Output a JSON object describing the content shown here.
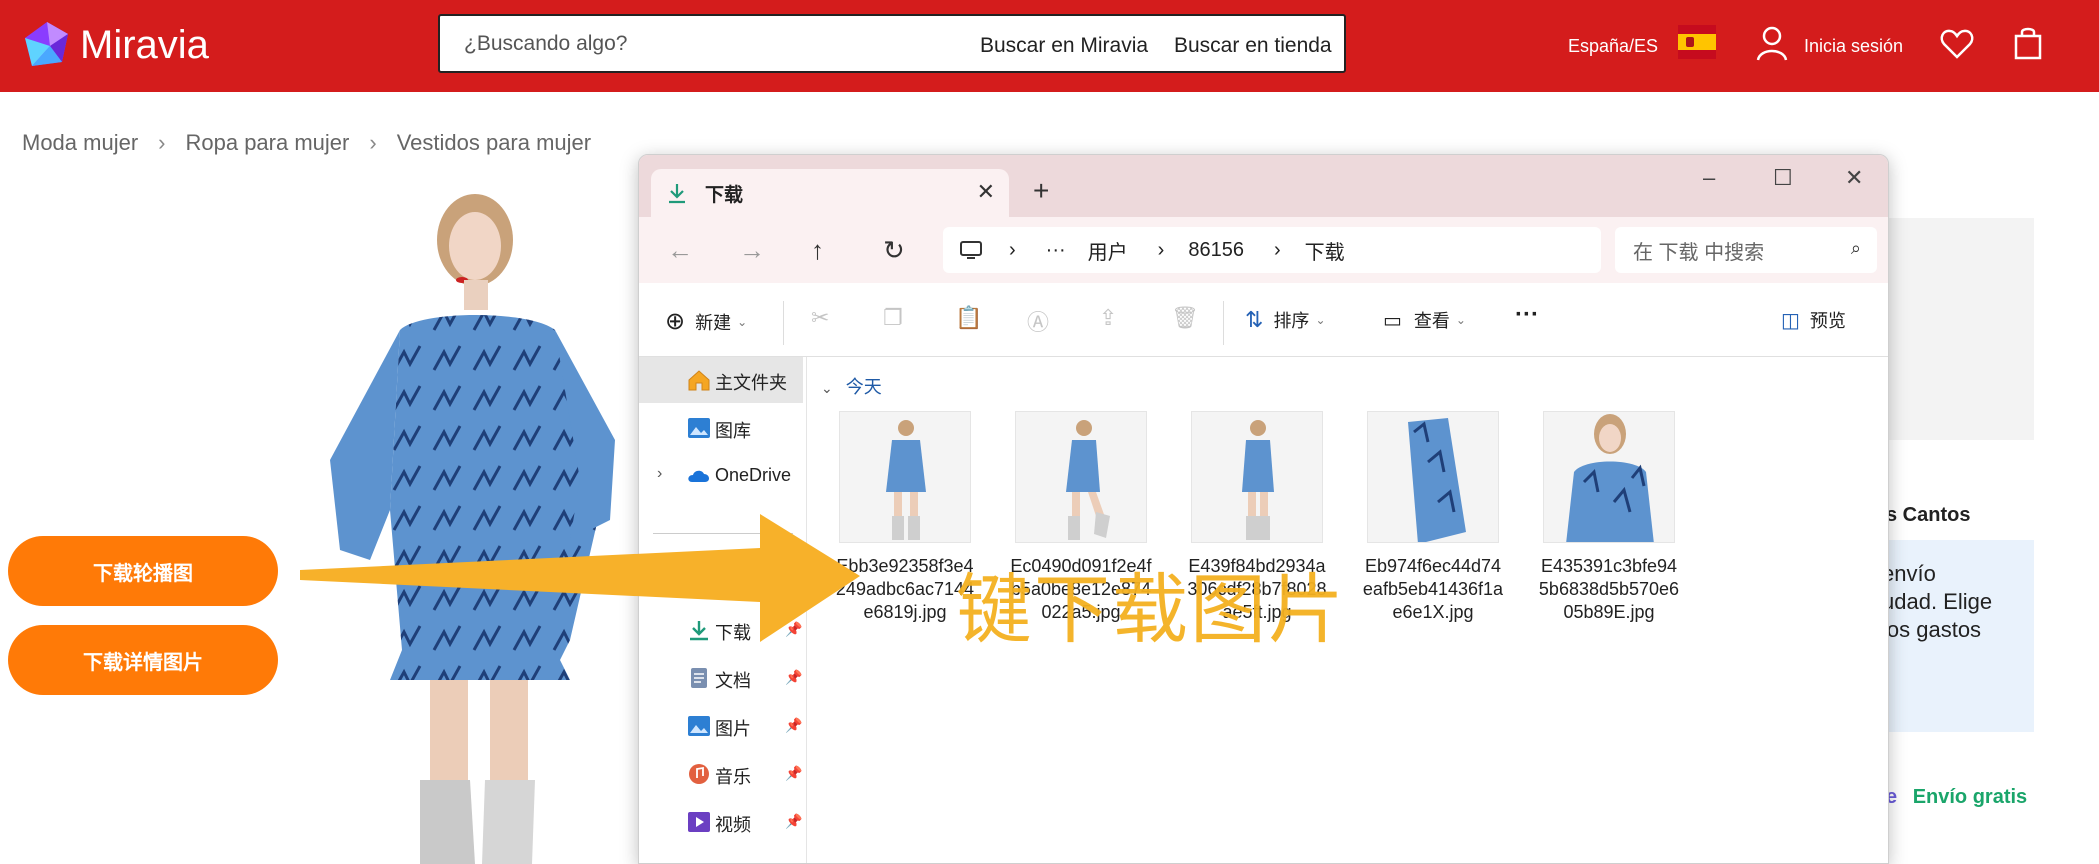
{
  "header": {
    "brand": "Miravia",
    "search_placeholder": "¿Buscando algo?",
    "search_miravia": "Buscar en Miravia",
    "search_store": "Buscar en tienda",
    "locale": "España/ES",
    "login": "Inicia sesión",
    "colors": {
      "header_bg": "#d41c1c"
    }
  },
  "breadcrumb": [
    "Moda mujer",
    "Ropa para mujer",
    "Vestidos para mujer"
  ],
  "buttons": {
    "download_carousel": "下载轮播图",
    "download_details": "下载详情图片"
  },
  "right_page": {
    "store_name": "s Cantos",
    "shipping_text": "envío\nudad. Elige\n los gastos",
    "free_shipping_prefix": "e",
    "free_shipping": "Envío gratis"
  },
  "explorer": {
    "tab_title": "下载",
    "address": {
      "more": "···",
      "users": "用户",
      "user": "86156",
      "folder": "下载"
    },
    "search_placeholder": "在 下载 中搜索",
    "toolbar": {
      "new": "新建",
      "sort": "排序",
      "view": "查看",
      "more": "···",
      "preview": "预览"
    },
    "sidebar": [
      {
        "label": "主文件夹",
        "icon": "home-icon",
        "pinned": false
      },
      {
        "label": "图库",
        "icon": "gallery-icon",
        "pinned": false
      },
      {
        "label": "OneDrive",
        "icon": "cloud-icon",
        "pinned": false
      },
      {
        "label": "下载",
        "icon": "download-icon",
        "pinned": true
      },
      {
        "label": "文档",
        "icon": "document-icon",
        "pinned": true
      },
      {
        "label": "图片",
        "icon": "picture-icon",
        "pinned": true
      },
      {
        "label": "音乐",
        "icon": "music-icon",
        "pinned": true
      },
      {
        "label": "视频",
        "icon": "video-icon",
        "pinned": true
      }
    ],
    "group_label": "今天",
    "files": [
      {
        "name": "Ebb3e92358f3e4249adbc6ac7144e6819j.jpg"
      },
      {
        "name": "Ec0490d091f2e4fb5a0be8e12e874022a5.jpg"
      },
      {
        "name": "E439f84bd2934a306cdf28b7f8028ae5ft.jpg"
      },
      {
        "name": "Eb974f6ec44d74eafb5eb41436f1ae6e1X.jpg"
      },
      {
        "name": "E435391c3bfe945b6838d5b570e605b89E.jpg"
      }
    ]
  },
  "overlay_text": "键下载图片"
}
